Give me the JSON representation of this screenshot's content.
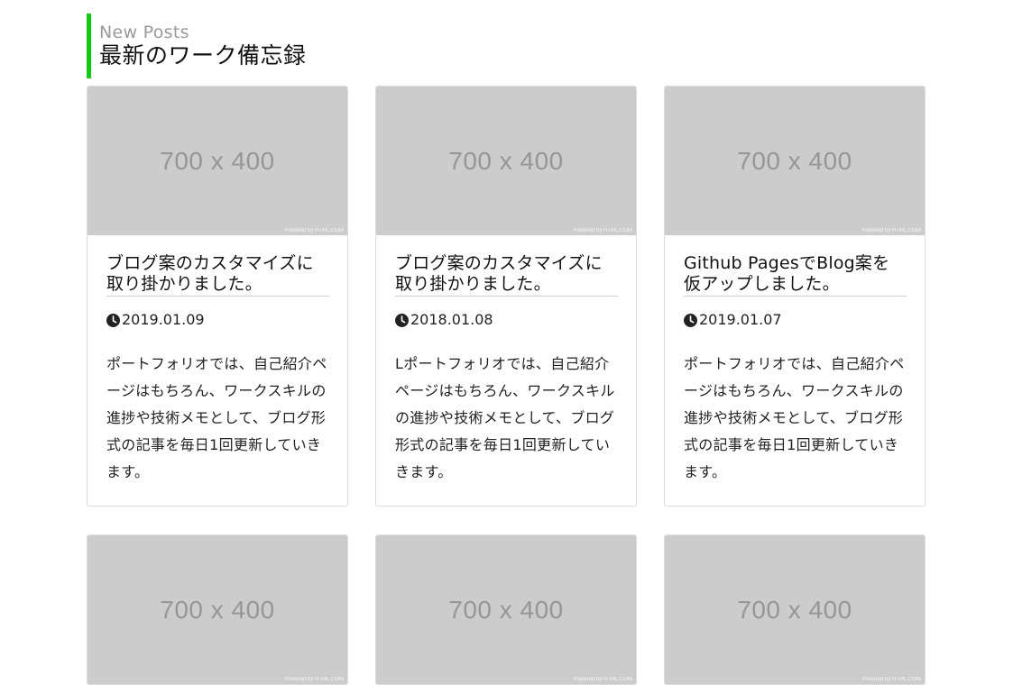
{
  "section": {
    "subtitle": "New Posts",
    "title": "最新のワーク備忘録"
  },
  "accent_color": "#14c814",
  "thumbnail": {
    "label": "700 x 400",
    "credit": "Powered by HTML.COM"
  },
  "posts": [
    {
      "title": "ブログ案のカスタマイズに取り掛かりました。",
      "date": "2019.01.09",
      "excerpt": "ポートフォリオでは、自己紹介ページはもちろん、ワークスキルの進捗や技術メモとして、ブログ形式の記事を毎日1回更新していきます。",
      "icon": "clock-icon"
    },
    {
      "title": "ブログ案のカスタマイズに取り掛かりました。",
      "date": "2018.01.08",
      "excerpt": "Lポートフォリオでは、自己紹介ページはもちろん、ワークスキルの進捗や技術メモとして、ブログ形式の記事を毎日1回更新していきます。",
      "icon": "clock-icon"
    },
    {
      "title": "Github PagesでBlog案を仮アップしました。",
      "date": "2019.01.07",
      "excerpt": "ポートフォリオでは、自己紹介ページはもちろん、ワークスキルの進捗や技術メモとして、ブログ形式の記事を毎日1回更新していきます。",
      "icon": "clock-icon"
    }
  ]
}
